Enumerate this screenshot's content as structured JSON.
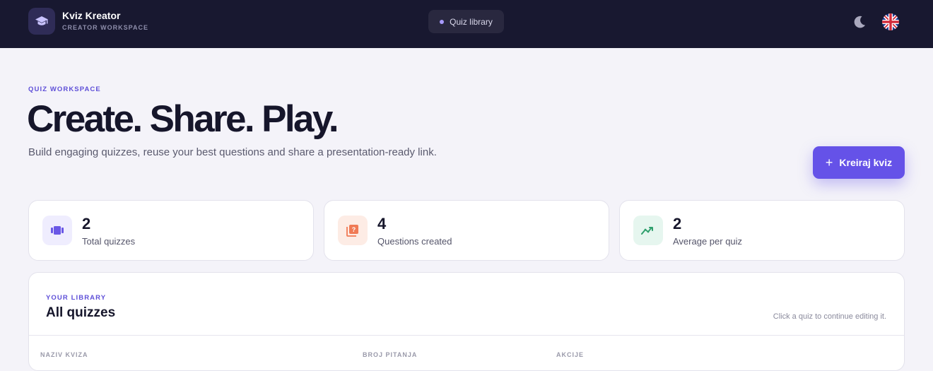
{
  "header": {
    "brand_name": "Kviz Kreator",
    "brand_sub": "CREATOR WORKSPACE",
    "nav_item": "Quiz library"
  },
  "hero": {
    "eyebrow": "QUIZ WORKSPACE",
    "title": "Create. Share. Play.",
    "description": "Build engaging quizzes, reuse your best questions and share a presentation-ready link.",
    "create_button": "Kreiraj kviz",
    "create_button_icon": "+"
  },
  "stats": [
    {
      "value": "2",
      "label": "Total quizzes",
      "icon": "film-icon",
      "bg": "#efedfe",
      "color": "#6a58e6"
    },
    {
      "value": "4",
      "label": "Questions created",
      "icon": "question-book-icon",
      "bg": "#fdece5",
      "color": "#f07a55"
    },
    {
      "value": "2",
      "label": "Average per quiz",
      "icon": "trending-icon",
      "bg": "#e6f6ef",
      "color": "#2e9f6c"
    }
  ],
  "library": {
    "eyebrow": "YOUR LIBRARY",
    "title": "All quizzes",
    "hint": "Click a quiz to continue editing it.",
    "columns": [
      "NAZIV KVIZA",
      "BROJ PITANJA",
      "AKCIJE"
    ]
  },
  "colors": {
    "accent": "#6552e8",
    "topbar": "#181830",
    "background": "#f4f3f9"
  }
}
